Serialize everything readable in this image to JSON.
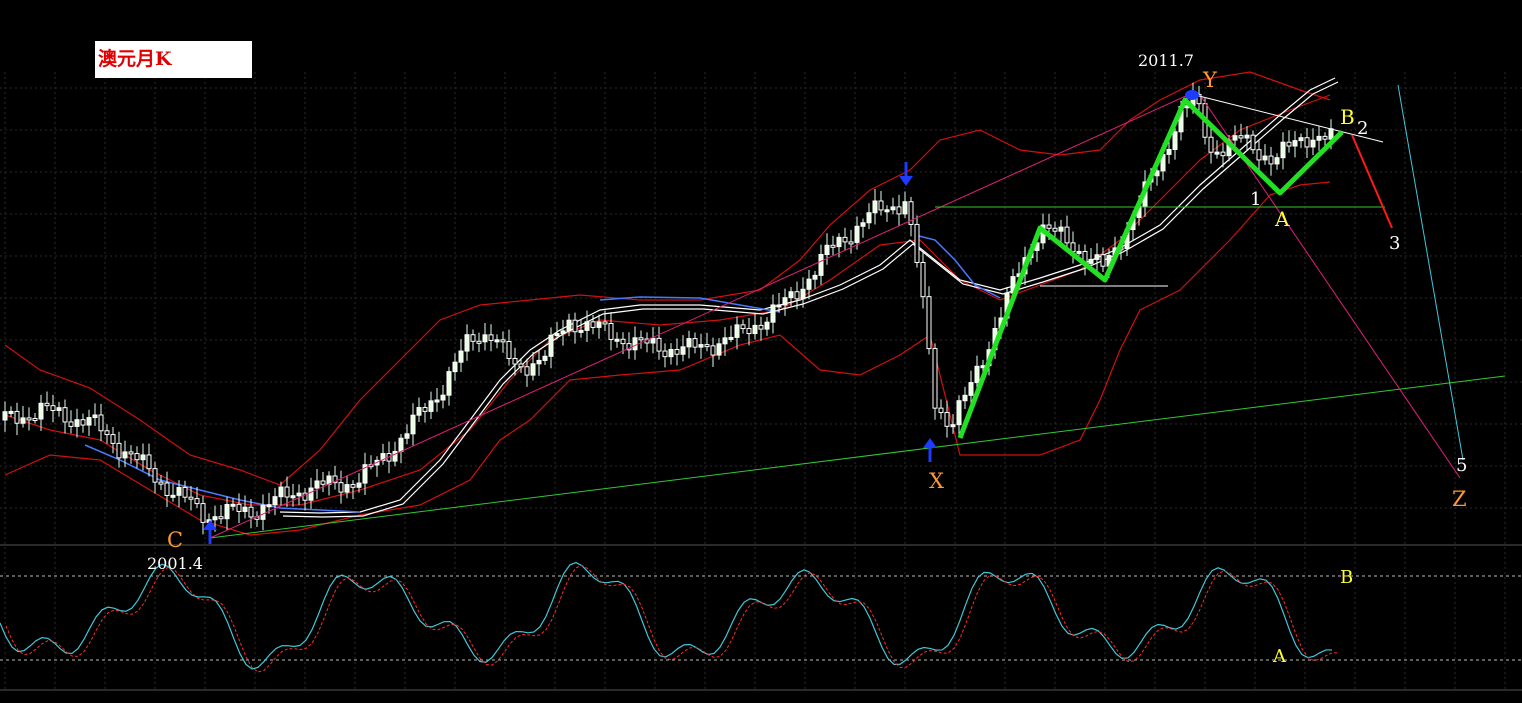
{
  "title": "澳元月K",
  "colors": {
    "background": "#000000",
    "grid": "#2a2a2a",
    "candle_up": "#e8ffe0",
    "candle_down": "#ffffff",
    "bollinger": "#d01010",
    "ma_white": "#ffffff",
    "ma_blue": "#4a78ff",
    "wave_green": "#22e022",
    "trend_green": "#32c832",
    "magenta": "#e0207a",
    "cyan": "#40c8d8",
    "red_arrow": "#ff1a1a",
    "label_orange": "#ff9933",
    "label_yellow": "#ffff33",
    "label_white": "#ffffff",
    "stoch_main": "#40c8d8",
    "stoch_signal": "#ff2a2a"
  },
  "chart_data": [
    {
      "type": "candlestick",
      "title": "澳元月K",
      "annotations": {
        "dates": {
          "start": "2001.4",
          "peak": "2011.7"
        },
        "wave_points": [
          "C",
          "X",
          "Y",
          "B",
          "A",
          "Z"
        ],
        "count_marks": [
          "1",
          "2",
          "3",
          "5"
        ],
        "arrows": [
          "down-arrow at pre-2008 top",
          "up-arrow at X low",
          "up-arrow at C low",
          "marker at Y high"
        ]
      },
      "overlays": [
        "Bollinger bands (red)",
        "moving average (white, double line)",
        "moving average (blue)"
      ],
      "grid": true
    },
    {
      "type": "line",
      "name": "stochastic oscillator",
      "series": [
        {
          "name": "",
          "color": "#40c8d8"
        },
        {
          "name": "",
          "color": "#ff2a2a"
        }
      ],
      "annotations": {
        "labels": [
          "B",
          "A"
        ]
      },
      "grid": true
    }
  ]
}
